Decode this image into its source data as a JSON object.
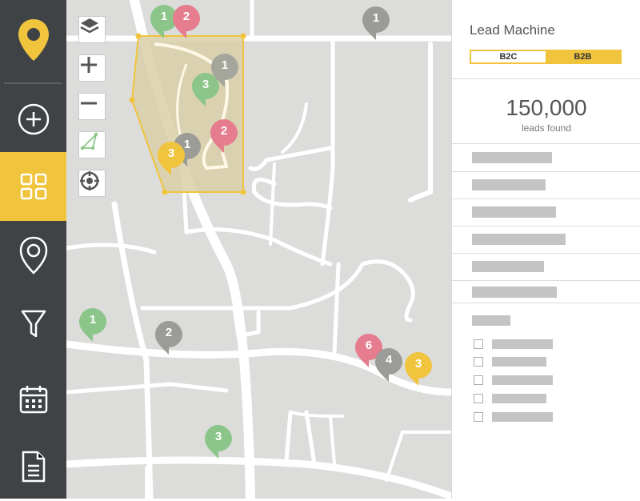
{
  "app": {
    "accent": "#f0c43c",
    "sidebar_bg": "#404345"
  },
  "sidebar": {
    "logo_icon": "location-pin-logo",
    "items": [
      {
        "name": "add",
        "icon": "plus-circle-icon"
      },
      {
        "name": "dashboard",
        "icon": "grid-icon",
        "active": true
      },
      {
        "name": "locations",
        "icon": "map-pin-icon"
      },
      {
        "name": "filter",
        "icon": "funnel-icon"
      },
      {
        "name": "calendar",
        "icon": "calendar-icon"
      },
      {
        "name": "reports",
        "icon": "document-icon"
      }
    ]
  },
  "map": {
    "tools": [
      "layers-icon",
      "zoom-in-icon",
      "zoom-out-icon",
      "polygon-draw-icon",
      "locate-icon"
    ],
    "markers": [
      {
        "label": "1",
        "color": "#8cc58a"
      },
      {
        "label": "2",
        "color": "#e57d8e"
      },
      {
        "label": "1",
        "color": "#9b9c97"
      },
      {
        "label": "1",
        "color": "#a4a59b"
      },
      {
        "label": "3",
        "color": "#8cc58a"
      },
      {
        "label": "2",
        "color": "#e57d8e"
      },
      {
        "label": "1",
        "color": "#9b9c97"
      },
      {
        "label": "3",
        "color": "#f0c43c"
      },
      {
        "label": "1",
        "color": "#8cc58a"
      },
      {
        "label": "2",
        "color": "#9b9c97"
      },
      {
        "label": "6",
        "color": "#e57d8e"
      },
      {
        "label": "4",
        "color": "#9b9c97"
      },
      {
        "label": "3",
        "color": "#f0c43c"
      },
      {
        "label": "3",
        "color": "#8cc58a"
      }
    ]
  },
  "panel": {
    "title": "Lead Machine",
    "toggle": {
      "left": "B2C",
      "right": "B2B",
      "selected": "B2B"
    },
    "count": "150,000",
    "count_label": "leads found"
  }
}
